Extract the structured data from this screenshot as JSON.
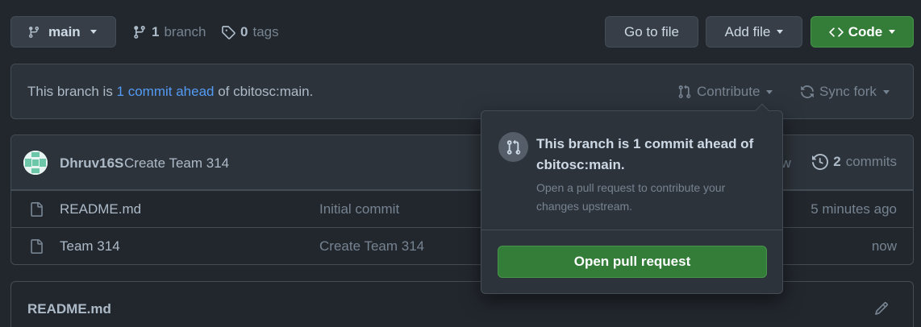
{
  "top": {
    "branch_label": "main",
    "branches_count": "1",
    "branches_label": "branch",
    "tags_count": "0",
    "tags_label": "tags",
    "goto_file": "Go to file",
    "add_file": "Add file",
    "code": "Code"
  },
  "status": {
    "prefix": "This branch is ",
    "ahead_link": "1 commit ahead",
    "suffix": " of cbitosc:main.",
    "contribute": "Contribute",
    "sync_fork": "Sync fork"
  },
  "commit": {
    "author": "Dhruv16S",
    "message": "Create Team 314",
    "time_partial": "ow",
    "commits_count": "2",
    "commits_label": "commits"
  },
  "files": [
    {
      "name": "README.md",
      "message": "Initial commit",
      "time": "5 minutes ago"
    },
    {
      "name": "Team 314",
      "message": "Create Team 314",
      "time": "now"
    }
  ],
  "readme": {
    "title": "README.md"
  },
  "popover": {
    "title": "This branch is 1 commit ahead of cbitosc:main.",
    "description": "Open a pull request to contribute your changes upstream.",
    "button": "Open pull request"
  },
  "colors": {
    "accent_green": "#347d39",
    "link_blue": "#539bf5",
    "background": "#22272e"
  },
  "icons": [
    "branch-icon",
    "git-branch-icon",
    "tag-icon",
    "code-icon",
    "pull-request-icon",
    "sync-icon",
    "history-icon",
    "file-icon",
    "pencil-icon",
    "avatar"
  ]
}
